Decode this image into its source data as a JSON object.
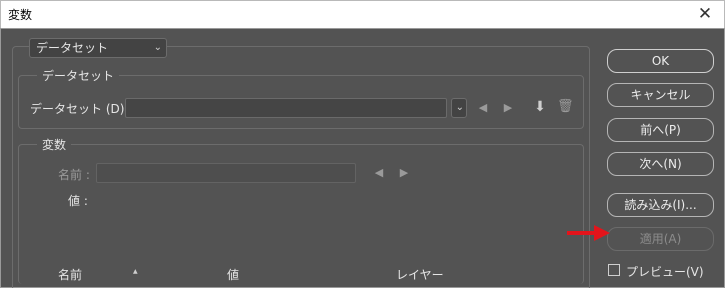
{
  "window": {
    "title": "変数",
    "close_label": "✕"
  },
  "top_select": {
    "value": "データセット"
  },
  "dataset_group": {
    "legend": "データセット",
    "field_label": "データセット (D) :",
    "field_value": ""
  },
  "variables_group": {
    "legend": "変数",
    "name_label": "名前 :",
    "value_label": "値 :"
  },
  "table": {
    "headers": [
      "名前",
      "値",
      "レイヤー"
    ],
    "sort_indicator": "▲"
  },
  "buttons": {
    "ok": "OK",
    "cancel": "キャンセル",
    "prev": "前へ(P)",
    "next": "次へ(N)",
    "import": "読み込み(I)...",
    "apply": "適用(A)"
  },
  "preview": {
    "label": "プレビュー(V)",
    "checked": false
  },
  "colors": {
    "annotation_arrow": "#e3141b",
    "dialog_bg": "#535353"
  },
  "icons": [
    "chevron-down-icon",
    "prev-arrow-icon",
    "next-arrow-icon",
    "save-dataset-icon",
    "trash-icon",
    "close-icon",
    "red-arrow-annotation"
  ]
}
